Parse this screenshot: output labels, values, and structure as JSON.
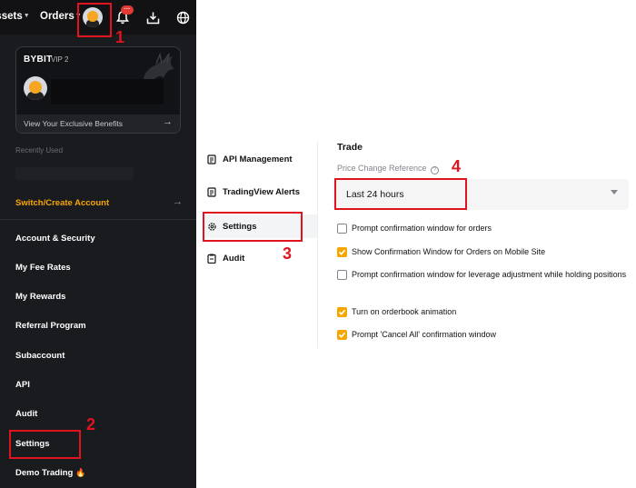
{
  "topbar": {
    "assets_label": "Assets",
    "orders_label": "Orders",
    "notification_count": "···"
  },
  "vip_card": {
    "brand": "BYBIT",
    "level": "VIP 2",
    "benefits_link": "View Your Exclusive Benefits"
  },
  "account_menu": {
    "recently_used": "Recently Used",
    "switch_account": "Switch/Create Account",
    "items": [
      {
        "label": "Account & Security"
      },
      {
        "label": "My Fee Rates"
      },
      {
        "label": "My Rewards"
      },
      {
        "label": "Referral Program"
      },
      {
        "label": "Subaccount"
      },
      {
        "label": "API"
      },
      {
        "label": "Audit"
      },
      {
        "label": "Settings"
      },
      {
        "label": "Demo Trading"
      }
    ]
  },
  "settings_menu": {
    "items": [
      {
        "label": "API Management"
      },
      {
        "label": "TradingView Alerts"
      },
      {
        "label": "Settings"
      },
      {
        "label": "Audit"
      }
    ]
  },
  "trade_settings": {
    "title": "Trade",
    "price_change_label": "Price Change Reference",
    "price_change_value": "Last 24 hours",
    "options": [
      {
        "label": "Prompt confirmation window for orders",
        "checked": false
      },
      {
        "label": "Show Confirmation Window for Orders on Mobile Site",
        "checked": true
      },
      {
        "label": "Prompt confirmation window for leverage adjustment while holding positions",
        "checked": false
      },
      {
        "label": "Turn on orderbook animation",
        "checked": true
      },
      {
        "label": "Prompt 'Cancel All' confirmation window",
        "checked": true
      }
    ]
  },
  "annotations": {
    "step1": "1",
    "step2": "2",
    "step3": "3",
    "step4": "4"
  },
  "colors": {
    "accent": "#f7a600",
    "panel_bg": "#1a1b1f",
    "annotation": "#e0141e"
  }
}
